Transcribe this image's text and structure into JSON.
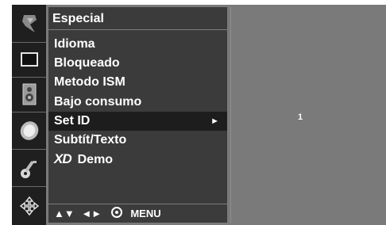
{
  "icon_strip": {
    "items": [
      {
        "name": "satellite-dish-icon"
      },
      {
        "name": "screen-icon"
      },
      {
        "name": "speaker-icon"
      },
      {
        "name": "clock-icon"
      },
      {
        "name": "key-icon"
      },
      {
        "name": "settings-arrows-icon"
      }
    ]
  },
  "menu": {
    "title": "Especial",
    "items": [
      {
        "label": "Idioma"
      },
      {
        "label": "Bloqueado"
      },
      {
        "label": "Metodo ISM"
      },
      {
        "label": "Bajo consumo"
      },
      {
        "label": "Set ID",
        "arrow": "►"
      },
      {
        "label": "Subtít/Texto"
      },
      {
        "logo": "XD",
        "label": "Demo"
      }
    ],
    "footer": {
      "nav_up_down": "▲▼",
      "nav_left_right": "◄►",
      "menu_label": "MENU"
    }
  },
  "submenu": {
    "value": "1"
  },
  "colors": {
    "background": "#7a7a7a",
    "panel": "#3b3b3b",
    "selected": "#1d1d1d",
    "icon_strip": "#1f1f1f"
  }
}
